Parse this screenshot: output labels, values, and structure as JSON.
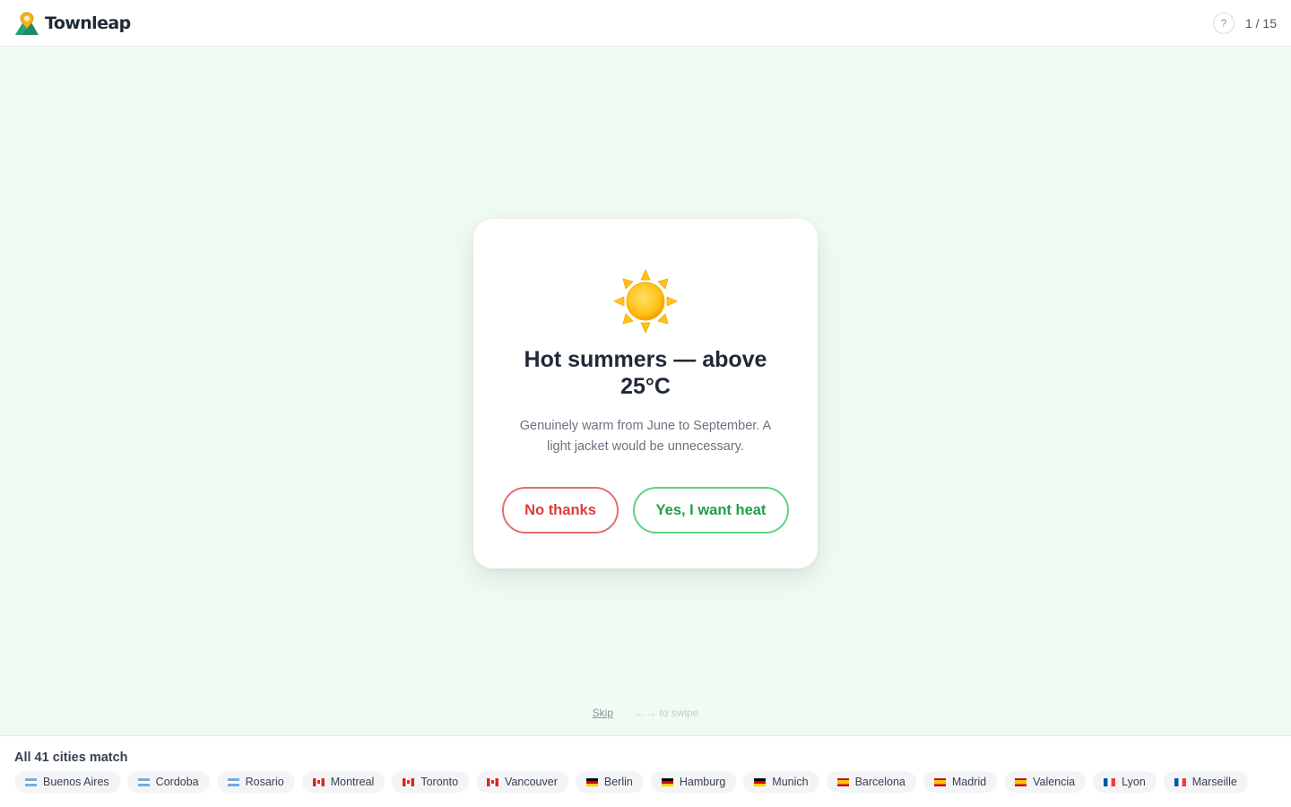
{
  "header": {
    "brand_name": "Townleap",
    "help_label": "?",
    "progress": "1 / 15"
  },
  "card": {
    "icon": "sun-icon",
    "title": "Hot summers — above 25°C",
    "description": "Genuinely warm from June to September. A light jacket would be unnecessary.",
    "no_label": "No thanks",
    "yes_label": "Yes, I want heat"
  },
  "hint": {
    "skip_label": "Skip",
    "swipe_hint": "←→ to swipe"
  },
  "bottom": {
    "match_label": "All 41 cities match",
    "cities": [
      {
        "name": "Buenos Aires",
        "flag": "ar"
      },
      {
        "name": "Cordoba",
        "flag": "ar"
      },
      {
        "name": "Rosario",
        "flag": "ar"
      },
      {
        "name": "Montreal",
        "flag": "ca"
      },
      {
        "name": "Toronto",
        "flag": "ca"
      },
      {
        "name": "Vancouver",
        "flag": "ca"
      },
      {
        "name": "Berlin",
        "flag": "de"
      },
      {
        "name": "Hamburg",
        "flag": "de"
      },
      {
        "name": "Munich",
        "flag": "de"
      },
      {
        "name": "Barcelona",
        "flag": "es"
      },
      {
        "name": "Madrid",
        "flag": "es"
      },
      {
        "name": "Valencia",
        "flag": "es"
      },
      {
        "name": "Lyon",
        "flag": "fr"
      },
      {
        "name": "Marseille",
        "flag": "fr"
      }
    ]
  },
  "colors": {
    "background": "#f0fbf2",
    "no_accent": "#dc3c3c",
    "yes_accent": "#1e9e4a"
  }
}
